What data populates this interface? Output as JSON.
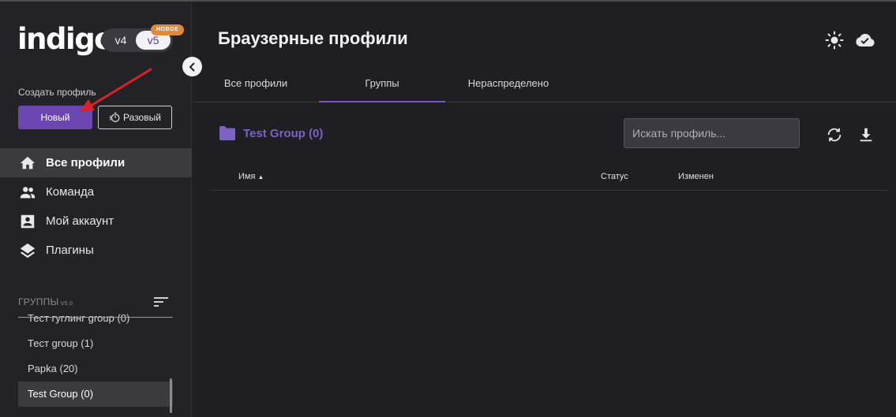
{
  "app": {
    "logo": "indigo",
    "version_v4": "v4",
    "version_v5": "v5",
    "badge_new": "НОВОЕ"
  },
  "sidebar": {
    "create_label": "Создать профиль",
    "new_button": "Новый",
    "oneoff_button": "Разовый",
    "nav": [
      {
        "label": "Все профили",
        "icon": "home-icon",
        "active": true
      },
      {
        "label": "Команда",
        "icon": "people-icon",
        "active": false
      },
      {
        "label": "Мой аккаунт",
        "icon": "account-box-icon",
        "active": false
      },
      {
        "label": "Плагины",
        "icon": "layers-icon",
        "active": false
      }
    ],
    "groups_header": "ГРУППЫ",
    "groups_version": "V5.0",
    "groups": [
      {
        "label": "Тест гуглинг group",
        "count": "(0)"
      },
      {
        "label": "Тест group",
        "count": "(1)"
      },
      {
        "label": "Papka",
        "count": "(20)"
      },
      {
        "label": "Test Group",
        "count": "(0)"
      }
    ]
  },
  "main": {
    "title": "Браузерные профили",
    "tabs": [
      {
        "label": "Все профили"
      },
      {
        "label": "Группы"
      },
      {
        "label": "Нераспределено"
      }
    ],
    "active_tab": "Группы",
    "group_title": "Test Group (0)",
    "search_placeholder": "Искать профиль...",
    "columns": {
      "name": "Имя",
      "status": "Статус",
      "modified": "Изменен"
    }
  },
  "colors": {
    "accent": "#6b46b0",
    "group_title": "#7d62c4",
    "badge": "#e0893b",
    "arrow": "#d4252a"
  }
}
